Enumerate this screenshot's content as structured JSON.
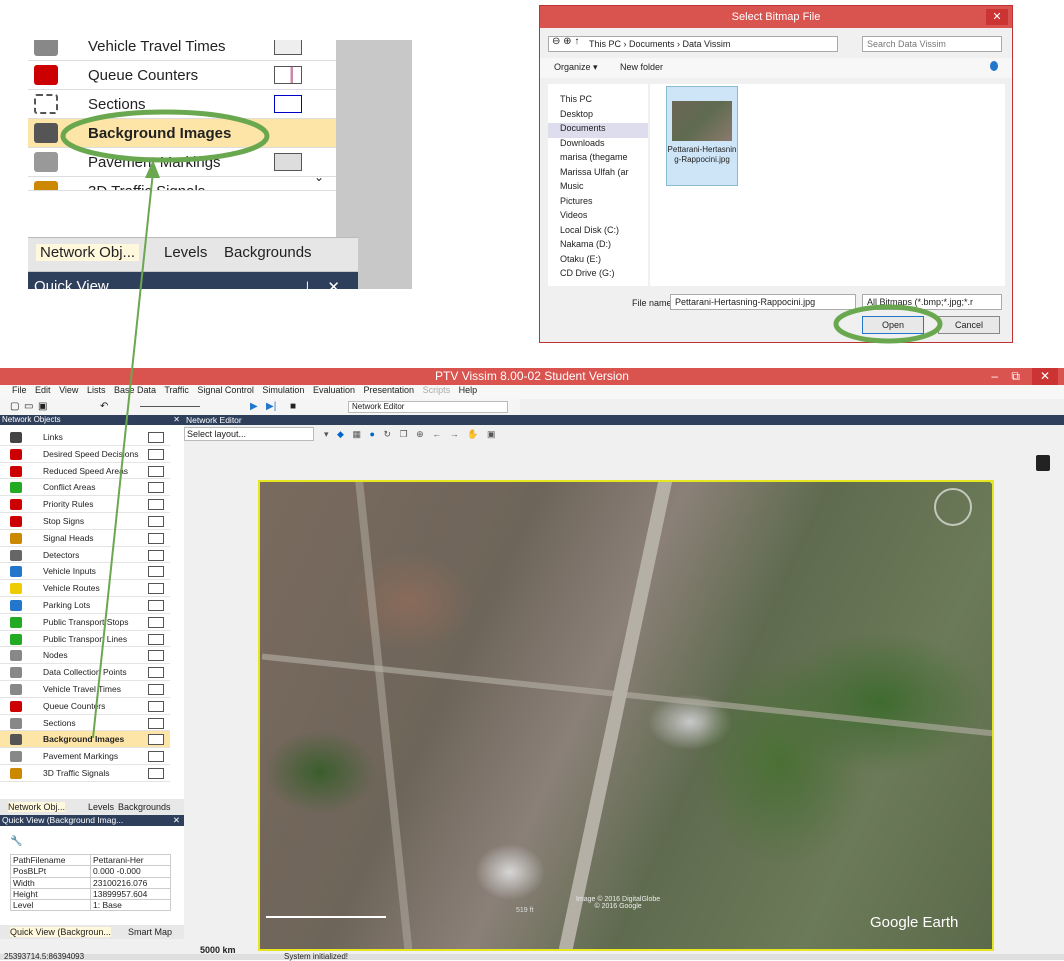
{
  "zoom_panel": {
    "items": [
      {
        "label": "Vehicle Travel Times",
        "icon": "clock-icon"
      },
      {
        "label": "Queue Counters",
        "icon": "queue-icon"
      },
      {
        "label": "Sections",
        "icon": "section-icon"
      },
      {
        "label": "Background Images",
        "icon": "background-image-icon"
      },
      {
        "label": "Pavement Markings",
        "icon": "pavement-icon"
      },
      {
        "label": "3D Traffic Signals",
        "icon": "traffic-signal-icon"
      }
    ],
    "tabs": [
      "Network Obj...",
      "Levels",
      "Backgrounds"
    ],
    "quick_view": "Quick View",
    "pin": "⊥",
    "close": "✕"
  },
  "dialog": {
    "title": "Select Bitmap File",
    "address": [
      "This PC",
      "Documents",
      "Data Vissim"
    ],
    "search_placeholder": "Search Data Vissim",
    "organize": "Organize ▾",
    "new_folder": "New folder",
    "tree": [
      "This PC",
      "Desktop",
      "Documents",
      "Downloads",
      "marisa (thegame",
      "Marissa Ulfah (ar",
      "Music",
      "Pictures",
      "Videos",
      "Local Disk (C:)",
      "Nakama (D:)",
      "Otaku (E:)",
      "CD Drive (G:)"
    ],
    "file": "Pettarani-Hertasning-Rappocini.jpg",
    "file_name_label": "File name:",
    "file_name_value": "Pettarani-Hertasning-Rappocini.jpg",
    "filter": "All Bitmaps (*.bmp;*.jpg;*.r",
    "open": "Open",
    "cancel": "Cancel"
  },
  "app": {
    "title": "PTV Vissim 8.00-02 Student Version",
    "menu": [
      "File",
      "Edit",
      "View",
      "Lists",
      "Base Data",
      "Traffic",
      "Signal Control",
      "Simulation",
      "Evaluation",
      "Presentation",
      "Scripts",
      "Help"
    ],
    "network_editor_select": "Network Editor",
    "network_objects_title": "Network Objects",
    "network_objects": [
      {
        "label": "Links",
        "color": "#444"
      },
      {
        "label": "Desired Speed Decisions",
        "color": "#c00"
      },
      {
        "label": "Reduced Speed Areas",
        "color": "#c00"
      },
      {
        "label": "Conflict Areas",
        "color": "#2a2"
      },
      {
        "label": "Priority Rules",
        "color": "#c00"
      },
      {
        "label": "Stop Signs",
        "color": "#c00"
      },
      {
        "label": "Signal Heads",
        "color": "#c80"
      },
      {
        "label": "Detectors",
        "color": "#666"
      },
      {
        "label": "Vehicle Inputs",
        "color": "#27c"
      },
      {
        "label": "Vehicle Routes",
        "color": "#ec0"
      },
      {
        "label": "Parking Lots",
        "color": "#27c"
      },
      {
        "label": "Public Transport Stops",
        "color": "#2a2"
      },
      {
        "label": "Public Transport Lines",
        "color": "#2a2"
      },
      {
        "label": "Nodes",
        "color": "#888"
      },
      {
        "label": "Data Collection Points",
        "color": "#888"
      },
      {
        "label": "Vehicle Travel Times",
        "color": "#888"
      },
      {
        "label": "Queue Counters",
        "color": "#c00"
      },
      {
        "label": "Sections",
        "color": "#888"
      },
      {
        "label": "Background Images",
        "color": "#555"
      },
      {
        "label": "Pavement Markings",
        "color": "#888"
      },
      {
        "label": "3D Traffic Signals",
        "color": "#c80"
      }
    ],
    "panel_tabs": [
      "Network Obj...",
      "Levels",
      "Backgrounds"
    ],
    "quick_view_title": "Quick View (Background Imag...",
    "quick_view_rows": [
      [
        "PathFilename",
        "Pettarani-Her"
      ],
      [
        "PosBLPt",
        "0.000 -0.000"
      ],
      [
        "Width",
        "23100216.076"
      ],
      [
        "Height",
        "13899957.604"
      ],
      [
        "Level",
        "1: Base"
      ]
    ],
    "bottom_tabs": [
      "Quick View (Backgroun...",
      "Smart Map"
    ],
    "editor_title": "Network Editor",
    "select_layout": "Select layout...",
    "scale": "5000 km",
    "map_scale": "519 ft",
    "imagery_credit": "Image © 2016 DigitalGlobe\n© 2016 Google",
    "watermark": "Google Earth",
    "status_coords": "25393714.5:86394093",
    "status_msg": "System initialized!"
  },
  "colors": {
    "accent_red": "#d9534f",
    "panel_navy": "#2e3f5c",
    "highlight": "#fde5a8",
    "annotation_green": "#6aa84f",
    "image_border": "#e6e620"
  }
}
